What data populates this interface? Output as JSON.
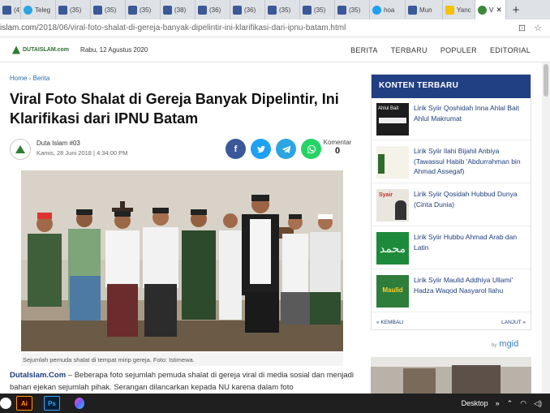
{
  "browser": {
    "tabs": [
      {
        "label": "(4) H",
        "icon": "facebook-icon",
        "kind": "fb"
      },
      {
        "label": "Teleg",
        "icon": "telegram-icon",
        "kind": "tg"
      },
      {
        "label": "(35)",
        "icon": "facebook-icon",
        "kind": "fb"
      },
      {
        "label": "(35)",
        "icon": "facebook-icon",
        "kind": "fb"
      },
      {
        "label": "(35)",
        "icon": "facebook-icon",
        "kind": "fb"
      },
      {
        "label": "(38)",
        "icon": "facebook-icon",
        "kind": "fb"
      },
      {
        "label": "(36)",
        "icon": "facebook-icon",
        "kind": "fb"
      },
      {
        "label": "(36)",
        "icon": "facebook-icon",
        "kind": "fb"
      },
      {
        "label": "(35)",
        "icon": "facebook-icon",
        "kind": "fb"
      },
      {
        "label": "(35)",
        "icon": "facebook-icon",
        "kind": "fb"
      },
      {
        "label": "(35)",
        "icon": "facebook-icon",
        "kind": "fb"
      },
      {
        "label": "hoa",
        "icon": "twitter-icon",
        "kind": "tw"
      },
      {
        "label": "Mun",
        "icon": "facebook-icon",
        "kind": "fb"
      },
      {
        "label": "Yanc",
        "icon": "flag-icon",
        "kind": "yellow"
      },
      {
        "label": "V",
        "icon": "dutaislam-icon",
        "kind": "du",
        "active": true
      }
    ],
    "url_host": "islam.com",
    "url_path": "/2018/06/viral-foto-shalat-di-gereja-banyak-dipelintir-ini-klarifikasi-dari-ipnu-batam.html"
  },
  "site": {
    "logo": "DUTAISLAM.com",
    "date": "Rabu, 12 Agustus 2020",
    "nav": [
      "BERITA",
      "TERBARU",
      "POPULER",
      "EDITORIAL"
    ]
  },
  "article": {
    "breadcrumb_home": "Home",
    "breadcrumb_sep": "›",
    "breadcrumb_section": "Berita",
    "title": "Viral Foto Shalat di Gereja Banyak Dipelintir, Ini Klarifikasi dari IPNU Batam",
    "author": "Duta Islam #03",
    "meta": "Kamis, 28 Juni 2018 |    4:34:00 PM",
    "comments_label": "Komentar",
    "comments_count": "0",
    "caption": "Sejumlah pemuda shalat di tempat mirip gereja. Foto: Istimewa.",
    "body_lead": "DutaIslam.Com",
    "body_text": " – Beberapa foto sejumlah pemuda shalat di gereja viral di media sosial dan menjadi bahan ejekan sejumlah pihak. Serangan dilancarkan kepada NU karena dalam foto"
  },
  "sidebar": {
    "heading": "KONTEN TERBARU",
    "items": [
      {
        "title": "Lirik Syiir Qoshidah Inna Ahlal Bait Ahlul Makrumat",
        "thumb_text": "Ahlul Bait"
      },
      {
        "title": "Lirik Syiir Ilahi Bijahil Anbiya (Tawassul Habib 'Abdurrahman bin Ahmad Assegaf)",
        "thumb_text": ""
      },
      {
        "title": "Lirik Syiir Qosidah Hubbud Dunya (Cinta Dunia)",
        "thumb_text": "Syair"
      },
      {
        "title": "Lirik Syiir Hubbu Ahmad Arab dan Latin",
        "thumb_text": ""
      },
      {
        "title": "Lirik Syiir Maulid Addhiya Ullami' Hadza Waqod Nasyarol Ilahu",
        "thumb_text": "Maulid"
      }
    ],
    "prev": "« KEMBALI",
    "next": "LANJUT »",
    "ad_by": "by",
    "ad_brand": "mgid"
  },
  "taskbar": {
    "desktop": "Desktop"
  }
}
